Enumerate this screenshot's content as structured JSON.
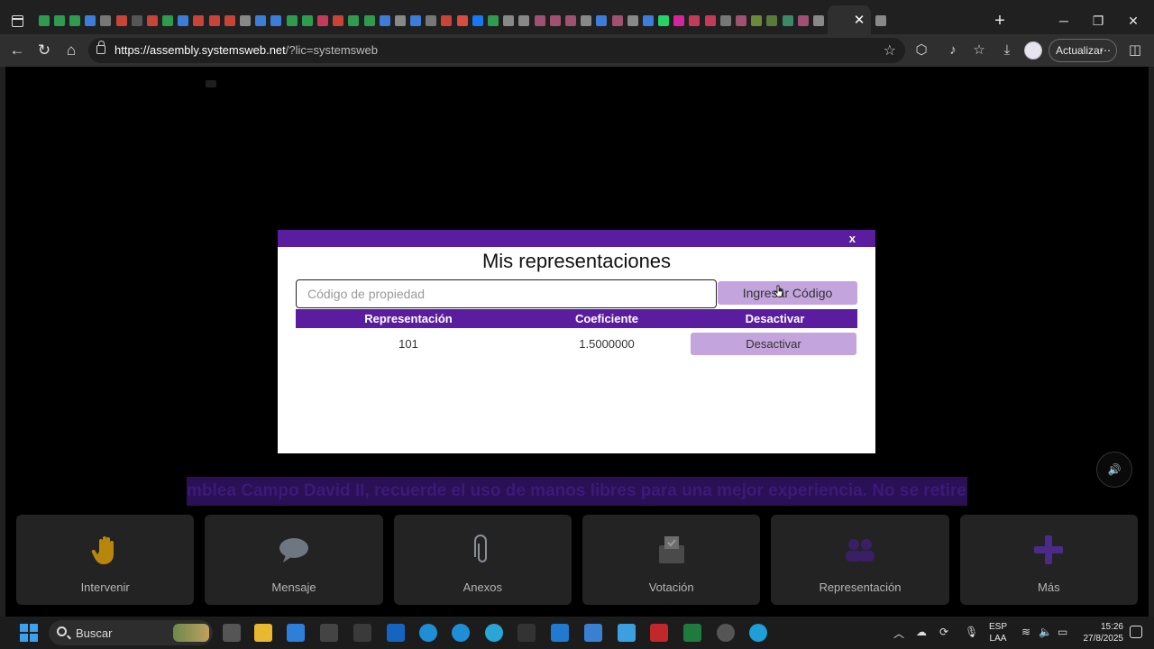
{
  "browser": {
    "url_host": "https://assembly.systemsweb.net",
    "url_path": "/?lic=systemsweb",
    "update_label": "Actualizar",
    "tab_close": "✕",
    "new_tab": "+",
    "tab_icon_colors": [
      "#2e9b4e",
      "#2e9b4e",
      "#2e9b4e",
      "#3b7dd8",
      "#777",
      "#c74436",
      "#555",
      "#c74436",
      "#2e9b4e",
      "#3b7dd8",
      "#c74436",
      "#c74436",
      "#c74436",
      "#888",
      "#3b7dd8",
      "#3b7dd8",
      "#2e9b4e",
      "#2e9b4e",
      "#c43b5a",
      "#c74436",
      "#2e9b4e",
      "#2e9b4e",
      "#3b7dd8",
      "#888",
      "#3b7dd8",
      "#777",
      "#c74436",
      "#d84b3e",
      "#1877f2",
      "#2e9b4e",
      "#888",
      "#888",
      "#a05070",
      "#a05070",
      "#a05070",
      "#888",
      "#3b7dd8",
      "#a05070",
      "#888",
      "#3b7dd8",
      "#25d366",
      "#d6249f",
      "#c43b5a",
      "#c43b5a",
      "#777",
      "#a05070",
      "#6a8a3a",
      "#5a7a3a",
      "#3a8a6a",
      "#a05070",
      "#888",
      "#b0803a",
      "#d07030",
      "#3b7dd8",
      "#888"
    ]
  },
  "modal": {
    "close_label": "x",
    "title": "Mis representaciones",
    "input_placeholder": "Código de propiedad",
    "submit_label": "Ingresar Código",
    "columns": [
      "Representación",
      "Coeficiente",
      "Desactivar"
    ],
    "rows": [
      {
        "representacion": "101",
        "coeficiente": "1.5000000",
        "action": "Desactivar"
      }
    ]
  },
  "ticker_text": "mblea Campo David II, recuerde el uso de manos libres para una mejor experiencia. No se retire la",
  "dock": [
    {
      "label": "Intervenir",
      "icon": "raised-hand-icon"
    },
    {
      "label": "Mensaje",
      "icon": "chat-bubble-icon"
    },
    {
      "label": "Anexos",
      "icon": "paperclip-icon"
    },
    {
      "label": "Votación",
      "icon": "ballot-box-icon"
    },
    {
      "label": "Representación",
      "icon": "people-icon"
    },
    {
      "label": "Más",
      "icon": "plus-icon"
    }
  ],
  "taskbar": {
    "search_label": "Buscar",
    "lang_line1": "ESP",
    "lang_line2": "LAA",
    "time": "15:26",
    "date": "27/8/2025"
  }
}
